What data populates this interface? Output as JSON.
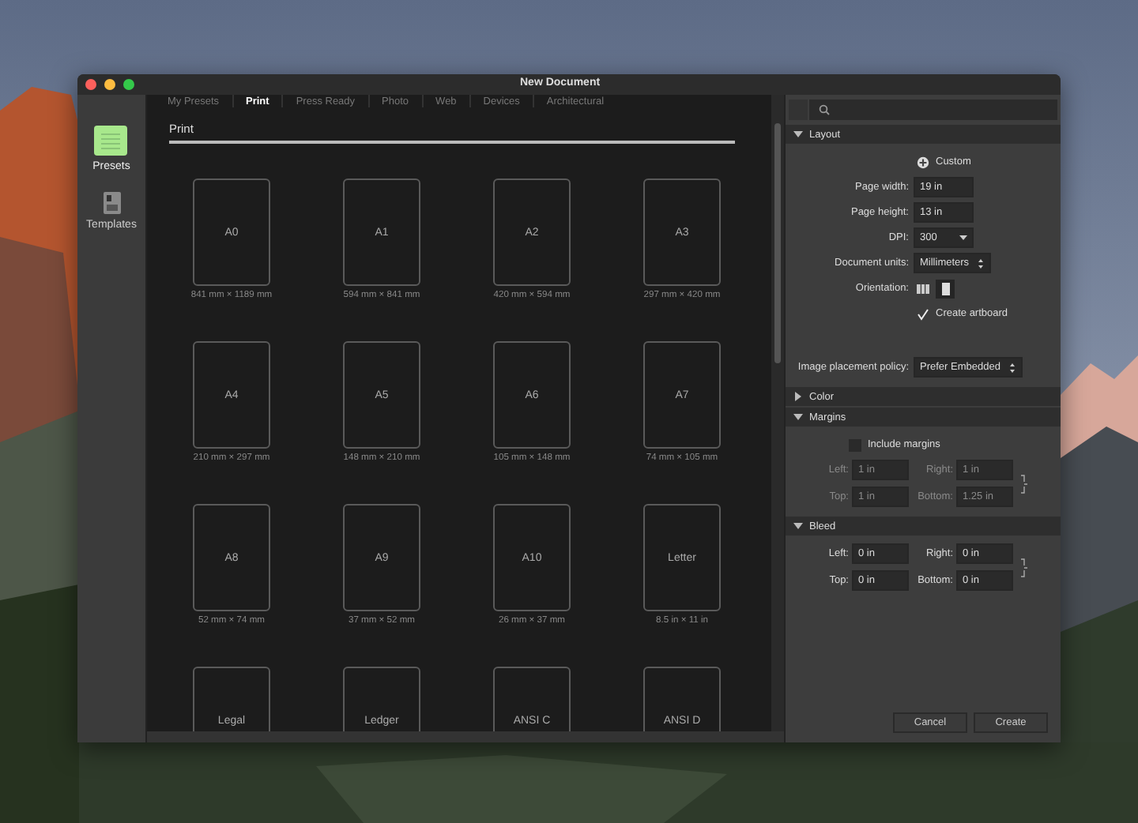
{
  "window": {
    "title": "New Document"
  },
  "sidebar": {
    "items": [
      {
        "label": "Presets",
        "selected": true
      },
      {
        "label": "Templates",
        "selected": false
      }
    ]
  },
  "tabs": [
    {
      "label": "My Presets",
      "selected": false
    },
    {
      "label": "Print",
      "selected": true
    },
    {
      "label": "Press Ready",
      "selected": false
    },
    {
      "label": "Photo",
      "selected": false
    },
    {
      "label": "Web",
      "selected": false
    },
    {
      "label": "Devices",
      "selected": false
    },
    {
      "label": "Architectural",
      "selected": false
    }
  ],
  "section_title": "Print",
  "presets": [
    {
      "name": "A0",
      "size": "841 mm × 1189 mm"
    },
    {
      "name": "A1",
      "size": "594 mm × 841 mm"
    },
    {
      "name": "A2",
      "size": "420 mm × 594 mm"
    },
    {
      "name": "A3",
      "size": "297 mm × 420 mm"
    },
    {
      "name": "A4",
      "size": "210 mm × 297 mm"
    },
    {
      "name": "A5",
      "size": "148 mm × 210 mm"
    },
    {
      "name": "A6",
      "size": "105 mm × 148 mm"
    },
    {
      "name": "A7",
      "size": "74 mm × 105 mm"
    },
    {
      "name": "A8",
      "size": "52 mm × 74 mm"
    },
    {
      "name": "A9",
      "size": "37 mm × 52 mm"
    },
    {
      "name": "A10",
      "size": "26 mm × 37 mm"
    },
    {
      "name": "Letter",
      "size": "8.5 in × 11 in"
    },
    {
      "name": "Legal"
    },
    {
      "name": "Ledger"
    },
    {
      "name": "ANSI C"
    },
    {
      "name": "ANSI D"
    }
  ],
  "panel": {
    "sections": [
      {
        "title": "Layout",
        "expanded": true,
        "rows": [
          {
            "kind": "action",
            "label": "Custom"
          },
          {
            "kind": "text",
            "label": "Page width:",
            "value": "19 in"
          },
          {
            "kind": "text",
            "label": "Page height:",
            "value": "13 in"
          },
          {
            "kind": "menu",
            "label": "DPI:",
            "value": "300"
          },
          {
            "kind": "stepper",
            "label": "Document units:",
            "value": "Millimeters"
          },
          {
            "kind": "orientation",
            "label": "Orientation:",
            "options": [
              {
                "kind": "landscape",
                "selected": false
              },
              {
                "kind": "portrait",
                "selected": true
              }
            ]
          },
          {
            "kind": "checkbox",
            "label": "Create artboard",
            "checked": true
          },
          {
            "kind": "stepper",
            "label": "Image placement policy:",
            "value": "Prefer Embedded"
          }
        ]
      },
      {
        "title": "Color",
        "expanded": false
      },
      {
        "title": "Margins",
        "expanded": true,
        "rows": [
          {
            "kind": "checkbox",
            "label": "Include margins",
            "checked": false
          },
          {
            "kind": "pairs",
            "disabled": true,
            "fields": [
              {
                "label": "Left:",
                "value": "1 in"
              },
              {
                "label": "Right:",
                "value": "1 in"
              },
              {
                "label": "Top:",
                "value": "1 in"
              },
              {
                "label": "Bottom:",
                "value": "1.25 in"
              }
            ]
          }
        ]
      },
      {
        "title": "Bleed",
        "expanded": true,
        "rows": [
          {
            "kind": "pairs",
            "disabled": false,
            "fields": [
              {
                "label": "Left:",
                "value": "0 in"
              },
              {
                "label": "Right:",
                "value": "0 in"
              },
              {
                "label": "Top:",
                "value": "0 in"
              },
              {
                "label": "Bottom:",
                "value": "0 in"
              }
            ]
          }
        ]
      }
    ]
  },
  "buttons": [
    {
      "label": "Cancel"
    },
    {
      "label": "Create"
    }
  ]
}
